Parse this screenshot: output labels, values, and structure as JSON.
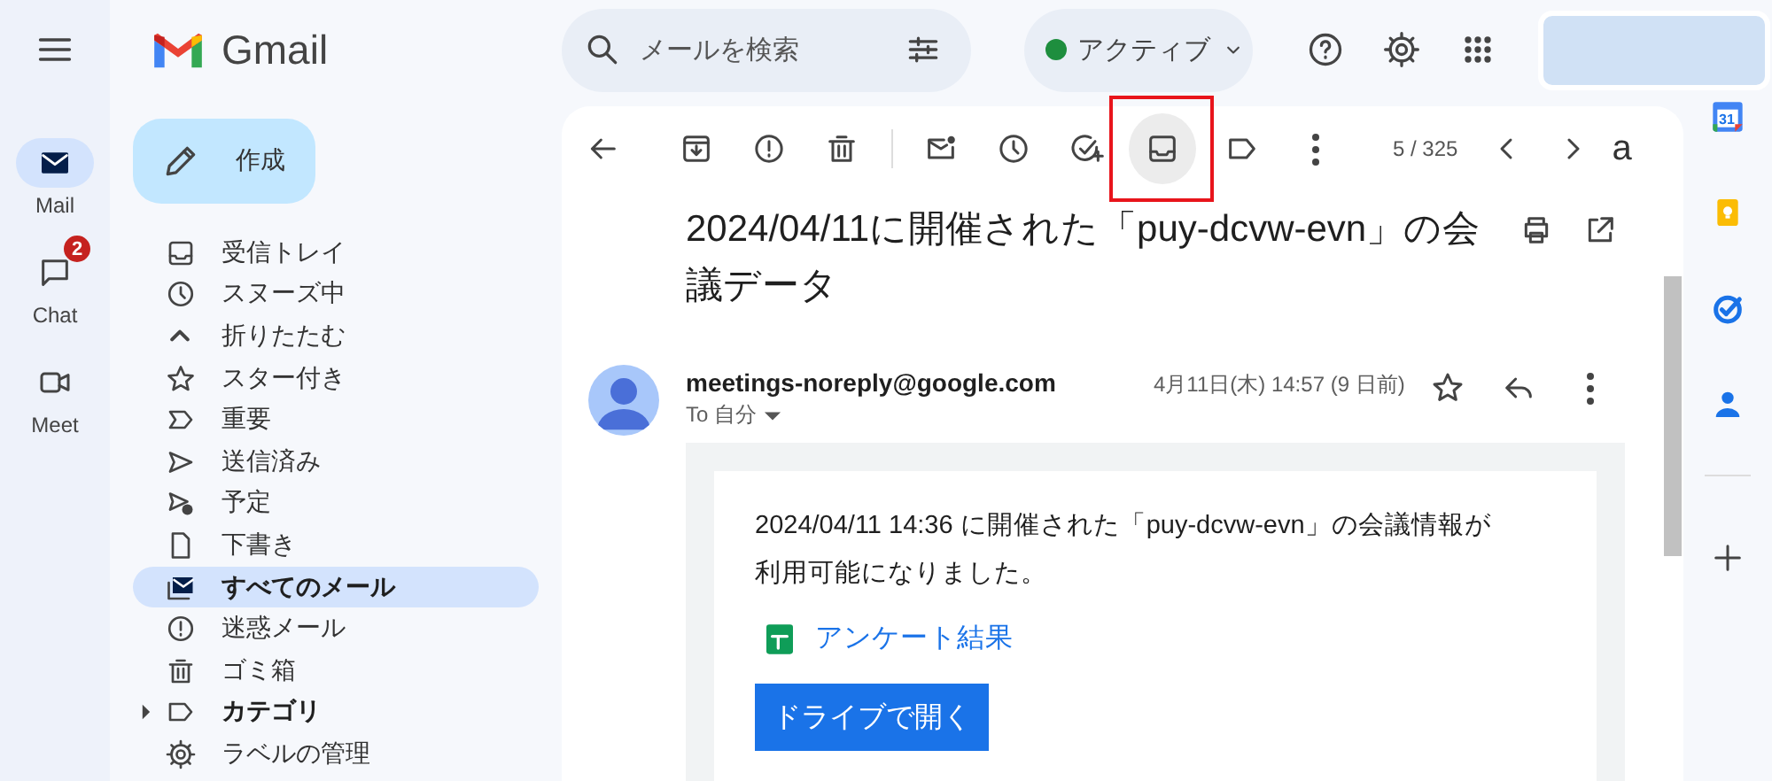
{
  "header": {
    "logo_text": "Gmail",
    "search": {
      "placeholder": "メールを検索"
    },
    "status": {
      "label": "アクティブ",
      "color": "#1e8e3e"
    }
  },
  "rail": [
    {
      "label": "Mail",
      "kind": "mail",
      "selected": true
    },
    {
      "label": "Chat",
      "kind": "chat",
      "selected": false,
      "badge": "2"
    },
    {
      "label": "Meet",
      "kind": "meet",
      "selected": false
    }
  ],
  "compose": {
    "label": "作成"
  },
  "folders": [
    {
      "label": "受信トレイ",
      "kind": "inbox",
      "selected": false,
      "bold": false
    },
    {
      "label": "スヌーズ中",
      "kind": "clock",
      "selected": false,
      "bold": false
    },
    {
      "label": "折りたたむ",
      "kind": "collapse",
      "selected": false,
      "bold": false
    },
    {
      "label": "スター付き",
      "kind": "star",
      "selected": false,
      "bold": false
    },
    {
      "label": "重要",
      "kind": "important",
      "selected": false,
      "bold": false
    },
    {
      "label": "送信済み",
      "kind": "sent",
      "selected": false,
      "bold": false
    },
    {
      "label": "予定",
      "kind": "scheduled",
      "selected": false,
      "bold": false
    },
    {
      "label": "下書き",
      "kind": "draft",
      "selected": false,
      "bold": false
    },
    {
      "label": "すべてのメール",
      "kind": "allmail",
      "selected": true,
      "bold": true
    },
    {
      "label": "迷惑メール",
      "kind": "spam",
      "selected": false,
      "bold": false
    },
    {
      "label": "ゴミ箱",
      "kind": "trash",
      "selected": false,
      "bold": false
    },
    {
      "label": "カテゴリ",
      "kind": "label",
      "selected": false,
      "bold": true,
      "expanded": false
    },
    {
      "label": "ラベルの管理",
      "kind": "gear",
      "selected": false,
      "bold": false
    }
  ],
  "toolbar": {
    "actions": [
      {
        "kind": "back",
        "highlighted": false
      },
      {
        "kind": "archive",
        "highlighted": false
      },
      {
        "kind": "spam",
        "highlighted": false
      },
      {
        "kind": "trash",
        "highlighted": false
      },
      {
        "kind": "divider"
      },
      {
        "kind": "unread",
        "highlighted": false
      },
      {
        "kind": "clock",
        "highlighted": false
      },
      {
        "kind": "addtask",
        "highlighted": false
      },
      {
        "kind": "inbox",
        "highlighted": true
      },
      {
        "kind": "label",
        "highlighted": false
      },
      {
        "kind": "more",
        "highlighted": false
      }
    ],
    "counter": "5 / 325",
    "cut_text": "a"
  },
  "message": {
    "subject": "2024/04/11に開催された「puy-dcvw-evn」の会議データ",
    "sender": "meetings-noreply@google.com",
    "recipient": "To 自分",
    "date": "4月11日(木) 14:57 (9 日前)",
    "body": "2024/04/11 14:36 に開催された「puy-dcvw-evn」の会議情報が利用可能になりました。",
    "link": "アンケート結果",
    "button": "ドライブで開く"
  },
  "side_panel": [
    {
      "kind": "calendar",
      "text": "31"
    },
    {
      "kind": "keep"
    },
    {
      "kind": "tasks"
    },
    {
      "kind": "contacts"
    },
    {
      "kind": "divider"
    },
    {
      "kind": "add"
    }
  ]
}
